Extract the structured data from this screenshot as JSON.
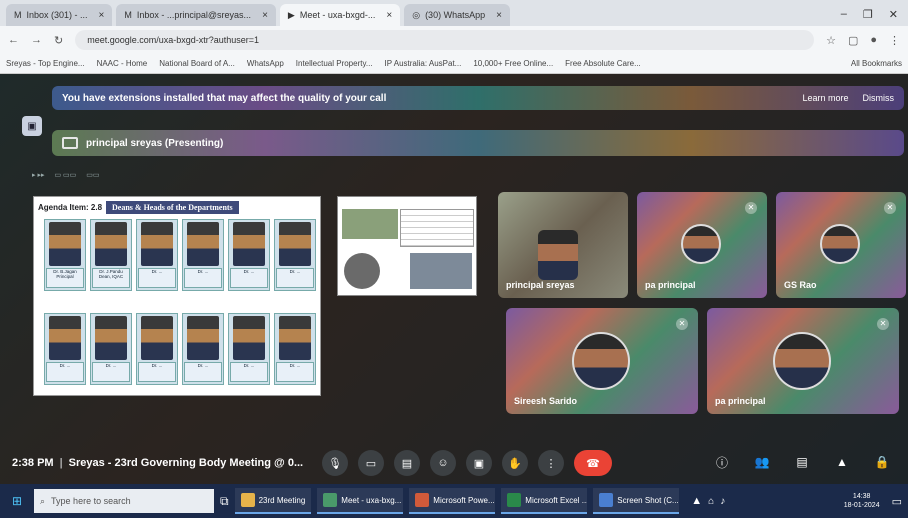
{
  "browser": {
    "tabs": [
      {
        "label": "Inbox (301) - ...",
        "active": false
      },
      {
        "label": "Inbox - ...principal@sreyas...",
        "active": false
      },
      {
        "label": "Meet - uxa-bxgd-...",
        "active": true
      },
      {
        "label": "(30) WhatsApp",
        "active": false
      }
    ],
    "url": "meet.google.com/uxa-bxgd-xtr?authuser=1",
    "bookmarks": [
      "Sreyas - Top Engine...",
      "NAAC - Home",
      "National Board of A...",
      "WhatsApp",
      "Intellectual Property...",
      "IP Australia: AusPat...",
      "10,000+ Free Online...",
      "Free Absolute Care...",
      "All Bookmarks"
    ]
  },
  "meet": {
    "banner_text": "You have extensions installed that may affect the quality of your call",
    "banner_learn_more": "Learn more",
    "banner_dismiss": "Dismiss",
    "presenting_label": "principal sreyas (Presenting)",
    "slide": {
      "agenda": "Agenda Item: 2.8",
      "title": "Deans & Heads of the Departments",
      "row1": [
        "Dr. B.Jagan Principal",
        "Dr. J.Pandu Dean, IQAC",
        "Dr. ...",
        "Dr. ...",
        "Dr. ...",
        "Dr. ..."
      ],
      "row2": [
        "Dr. ...",
        "Dr. ...",
        "Dr. ...",
        "Dr. ...",
        "Dr. ...",
        "Dr. ..."
      ]
    },
    "participants": [
      {
        "name": "principal sreyas"
      },
      {
        "name": "pa principal"
      },
      {
        "name": "GS Rao"
      },
      {
        "name": "Sireesh Sarido"
      },
      {
        "name": "pa principal"
      }
    ],
    "time": "2:38 PM",
    "meeting_title": "Sreyas - 23rd Governing Body Meeting @ 0..."
  },
  "taskbar": {
    "search_placeholder": "Type here to search",
    "items": [
      "23rd Meeting",
      "Meet - uxa-bxg...",
      "Microsoft Powe...",
      "Microsoft Excel ...",
      "Screen Shot (C..."
    ],
    "clock_time": "14:38",
    "clock_date": "18-01-2024"
  }
}
